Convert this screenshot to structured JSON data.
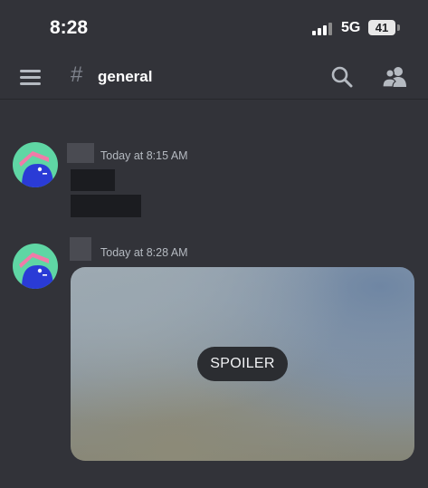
{
  "status_bar": {
    "time": "8:28",
    "network": "5G",
    "battery": "41"
  },
  "header": {
    "menu_icon": "hamburger-icon",
    "channel_icon": "hash-icon",
    "channel_name": "general",
    "search_icon": "search-icon",
    "members_icon": "members-icon"
  },
  "messages": [
    {
      "timestamp": "Today at 8:15 AM"
    },
    {
      "timestamp": "Today at 8:28 AM",
      "attachment_label": "SPOILER"
    }
  ],
  "colors": {
    "background": "#323339",
    "accent_avatar_bg": "#5fd6a4",
    "avatar_character": "#2a3bd6"
  }
}
